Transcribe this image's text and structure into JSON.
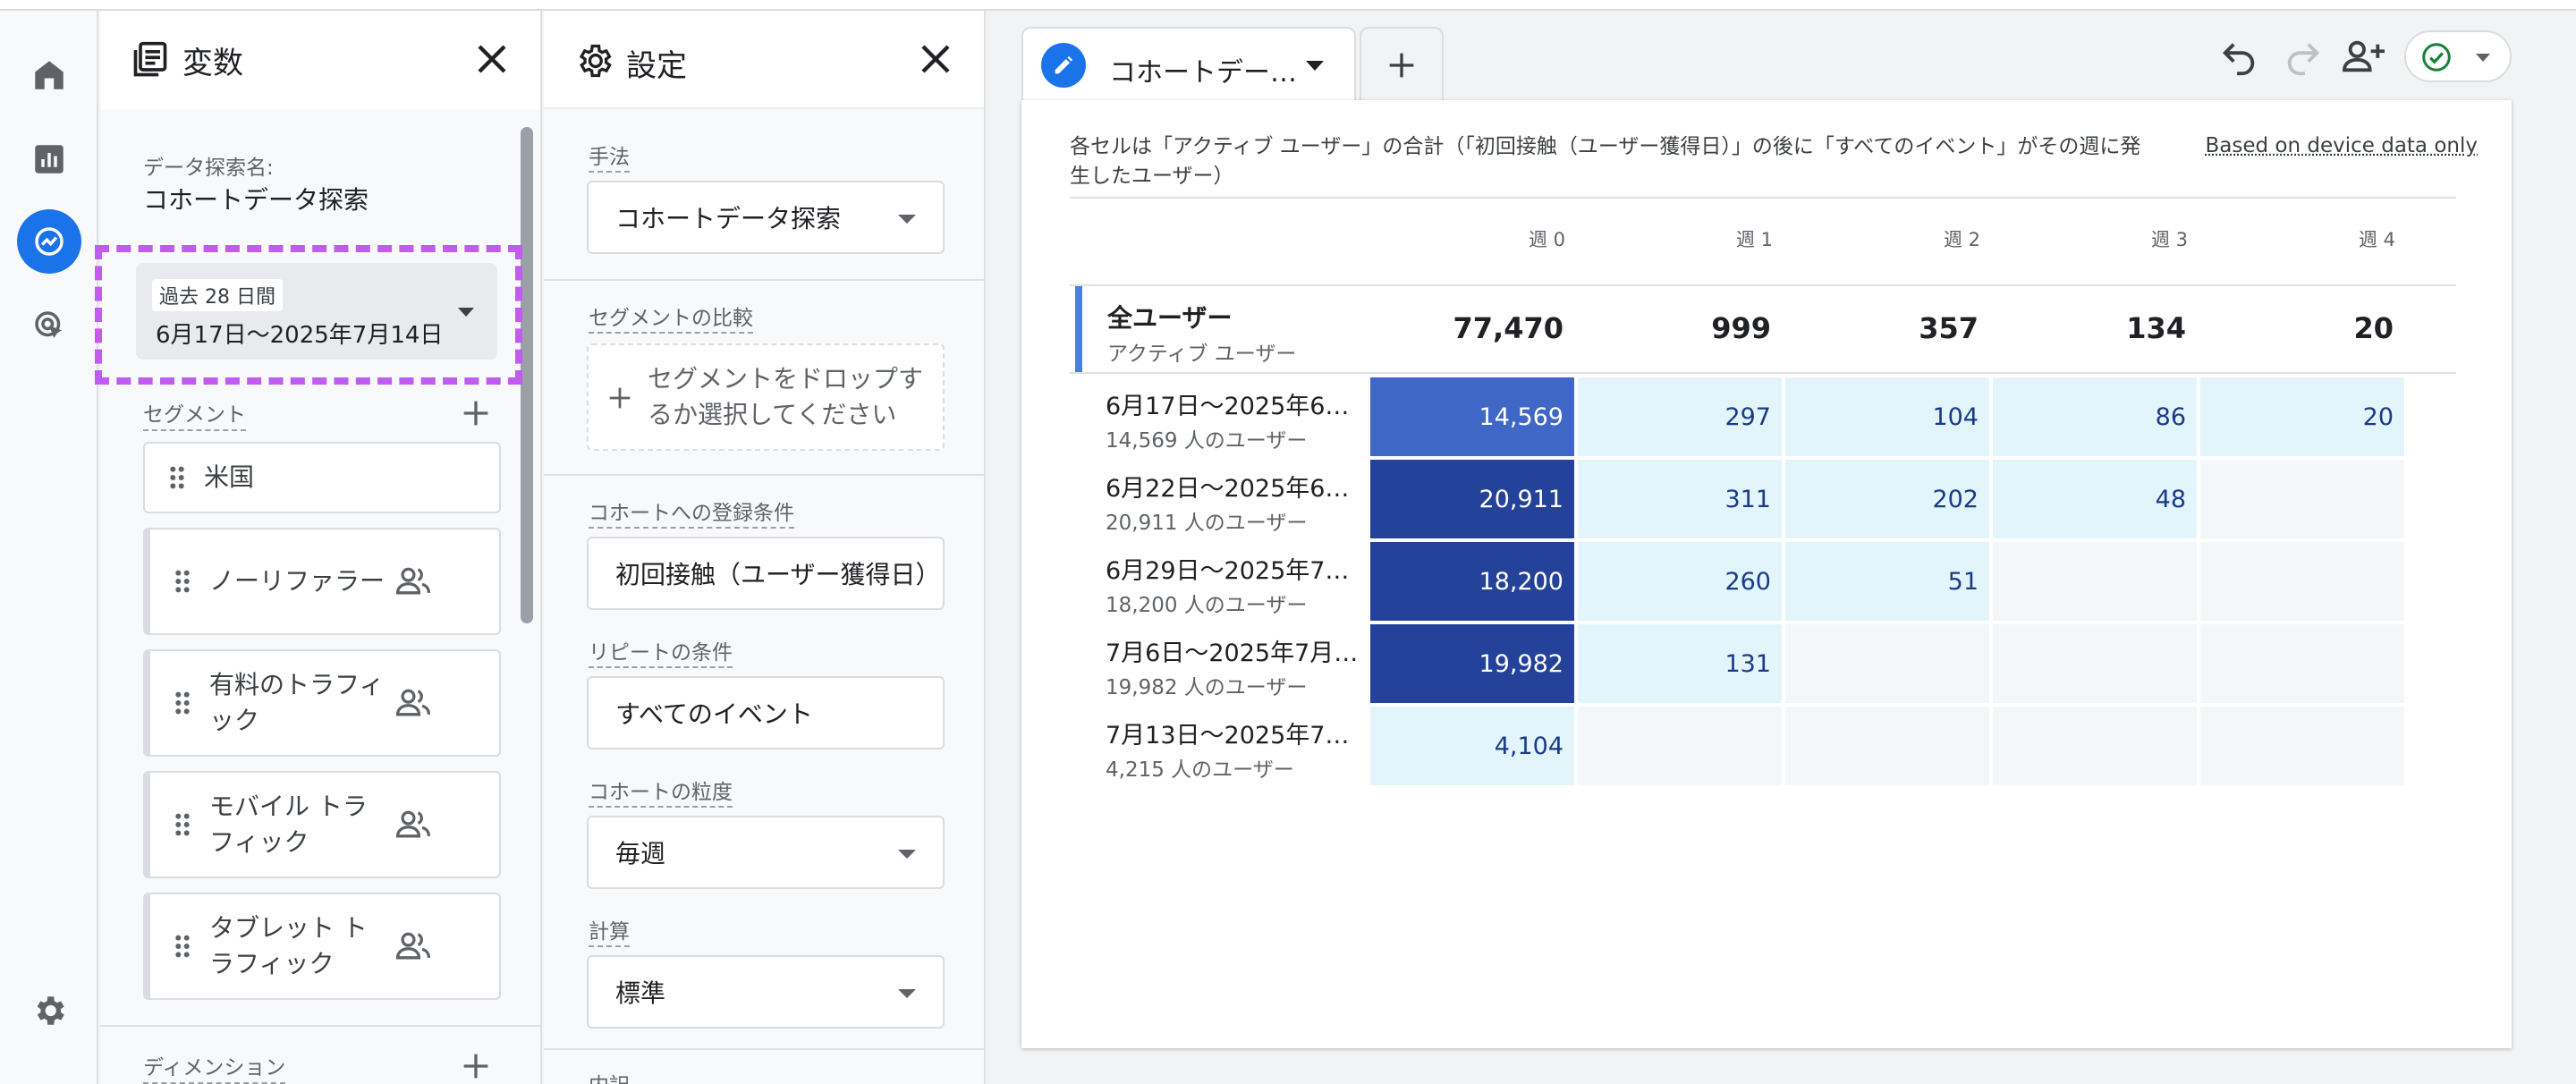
{
  "variables_panel": {
    "title": "変数",
    "exploration_name_label": "データ探索名:",
    "exploration_name": "コホートデータ探索",
    "date_range_label": "過去 28 日間",
    "date_range": "6月17日〜2025年7月14日",
    "segments_label": "セグメント",
    "segments": [
      {
        "label": "米国",
        "has_people_icon": false
      },
      {
        "label": "ノーリファラー",
        "has_people_icon": true
      },
      {
        "label": "有料のトラフィック",
        "has_people_icon": true
      },
      {
        "label": "モバイル トラフィック",
        "has_people_icon": true
      },
      {
        "label": "タブレット トラフィック",
        "has_people_icon": true
      }
    ],
    "dimensions_label": "ディメンション"
  },
  "settings_panel": {
    "title": "設定",
    "technique_label": "手法",
    "technique_value": "コホートデータ探索",
    "segment_compare_label": "セグメントの比較",
    "segment_drop_text": "セグメントをドロップするか選択してください",
    "inclusion_label": "コホートへの登録条件",
    "inclusion_value": "初回接触（ユーザー獲得日）",
    "return_label": "リピートの条件",
    "return_value": "すべてのイベント",
    "granularity_label": "コホートの粒度",
    "granularity_value": "毎週",
    "calculation_label": "計算",
    "calculation_value": "標準",
    "breakdown_label": "内訳"
  },
  "tab": {
    "label": "コホートデー…"
  },
  "report": {
    "description": "各セルは「アクティブ ユーザー」の合計（「初回接触（ユーザー獲得日）」の後に「すべてのイベント」がその週に発生したユーザー）",
    "based_on": "Based on device data only",
    "weeks": [
      "週 0",
      "週 1",
      "週 2",
      "週 3",
      "週 4"
    ],
    "total": {
      "title": "全ユーザー",
      "subtitle": "アクティブ ユーザー",
      "values": [
        "77,470",
        "999",
        "357",
        "134",
        "20"
      ]
    },
    "rows": [
      {
        "label": "6月17日〜2025年6…",
        "users": "14,569 人のユーザー",
        "values": [
          "14,569",
          "297",
          "104",
          "86",
          "20"
        ]
      },
      {
        "label": "6月22日〜2025年6…",
        "users": "20,911 人のユーザー",
        "values": [
          "20,911",
          "311",
          "202",
          "48",
          null
        ]
      },
      {
        "label": "6月29日〜2025年7…",
        "users": "18,200 人のユーザー",
        "values": [
          "18,200",
          "260",
          "51",
          null,
          null
        ]
      },
      {
        "label": "7月6日〜2025年7月…",
        "users": "19,982 人のユーザー",
        "values": [
          "19,982",
          "131",
          null,
          null,
          null
        ]
      },
      {
        "label": "7月13日〜2025年7…",
        "users": "4,215 人のユーザー",
        "values": [
          "4,104",
          null,
          null,
          null,
          null
        ]
      }
    ]
  },
  "colors": {
    "accent": "#1a73e8",
    "highlight": "#c05cf0",
    "cell_dark": "#25429a",
    "cell_mid": "#3f67c6",
    "cell_light": "#e1f5fa",
    "cell_empty": "#f5f6f7"
  },
  "icons": {
    "rail": [
      "home-icon",
      "bar-chart-icon",
      "explore-icon",
      "advertising-icon",
      "settings-gear-icon"
    ],
    "toolbar": [
      "undo-icon",
      "redo-icon",
      "share-person-add-icon",
      "check-circle-icon"
    ]
  }
}
